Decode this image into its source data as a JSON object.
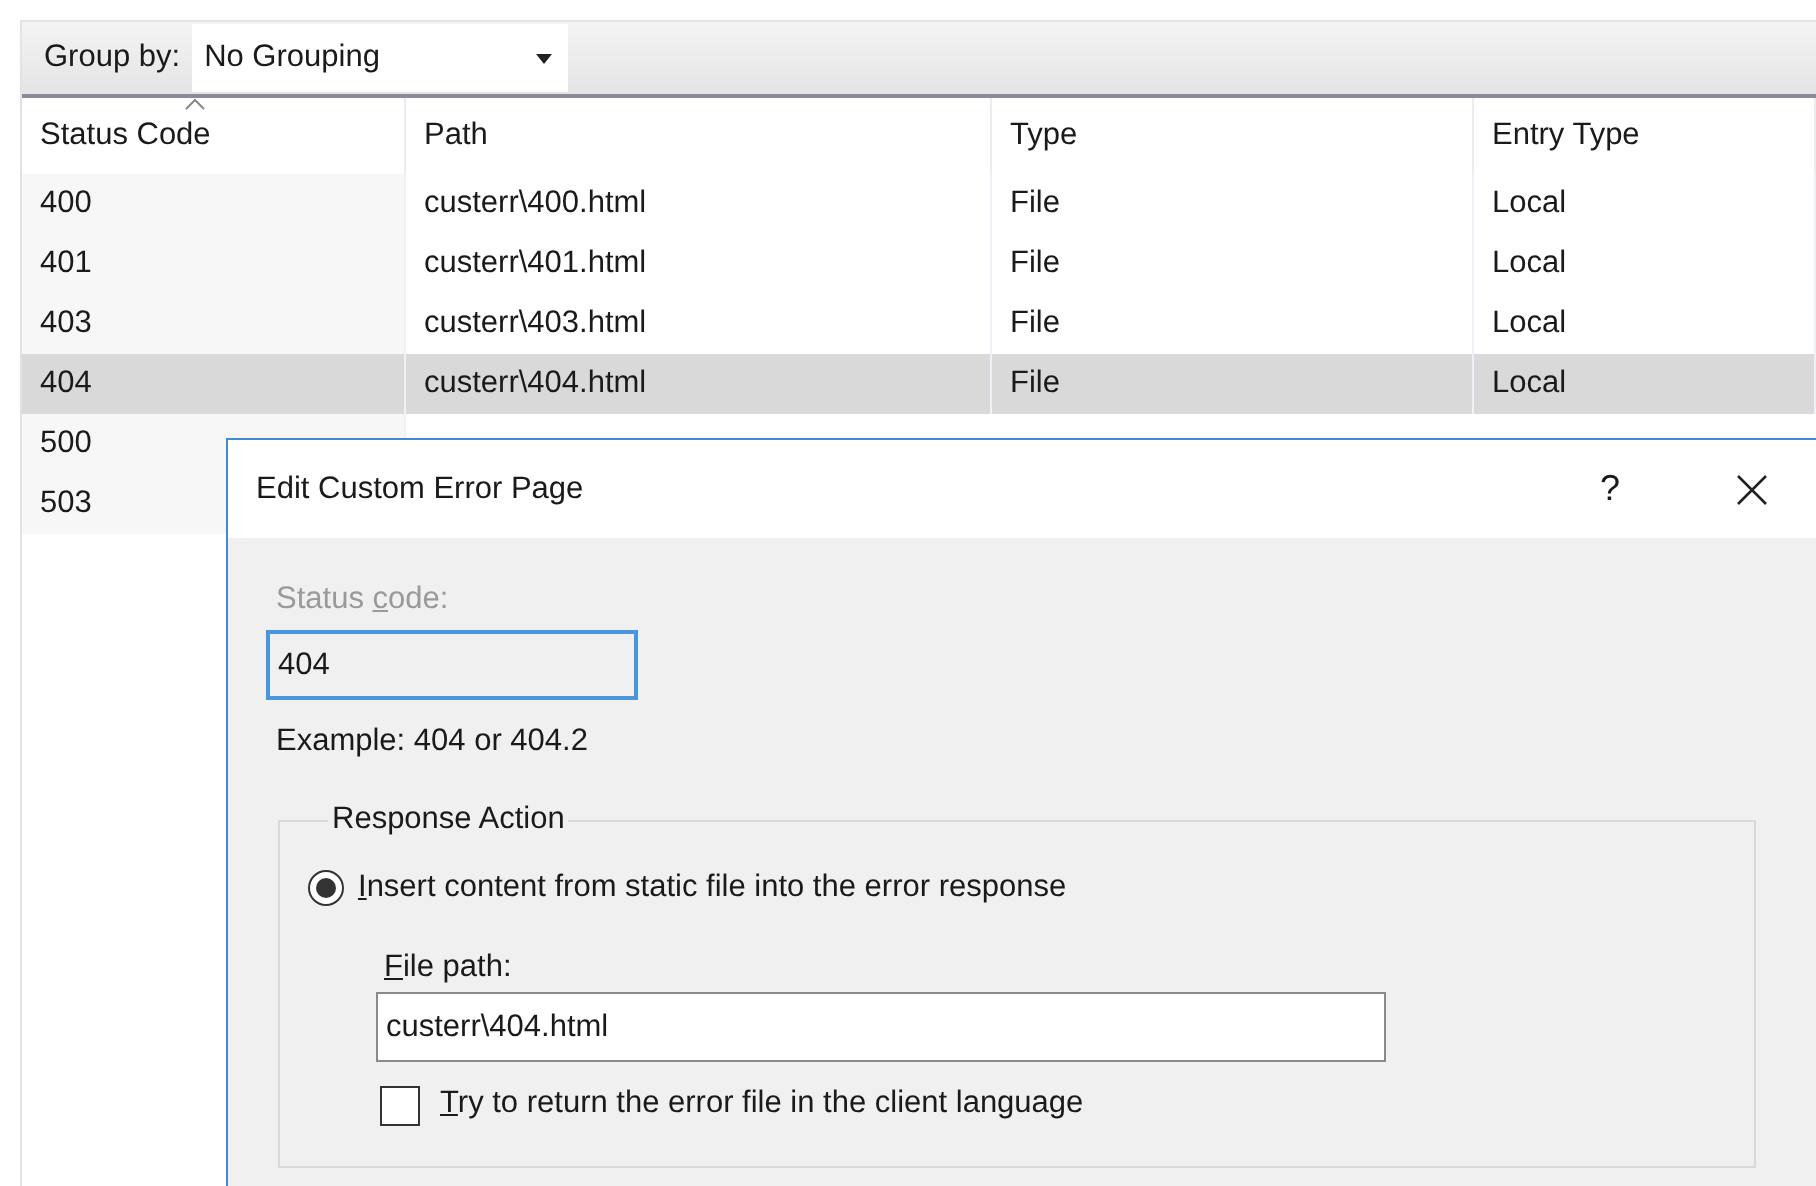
{
  "toolbar": {
    "group_by_label": "Group by:",
    "group_by_value": "No Grouping"
  },
  "table": {
    "columns": [
      {
        "label": "Status Code",
        "sorted": true
      },
      {
        "label": "Path",
        "sorted": false
      },
      {
        "label": "Type",
        "sorted": false
      },
      {
        "label": "Entry Type",
        "sorted": false
      }
    ],
    "rows": [
      {
        "cells": [
          "400",
          "custerr\\400.html",
          "File",
          "Local"
        ],
        "selected": false
      },
      {
        "cells": [
          "401",
          "custerr\\401.html",
          "File",
          "Local"
        ],
        "selected": false
      },
      {
        "cells": [
          "403",
          "custerr\\403.html",
          "File",
          "Local"
        ],
        "selected": false
      },
      {
        "cells": [
          "404",
          "custerr\\404.html",
          "File",
          "Local"
        ],
        "selected": true
      },
      {
        "cells": [
          "500"
        ],
        "selected": false
      },
      {
        "cells": [
          "503"
        ],
        "selected": false
      }
    ]
  },
  "dialog": {
    "title": "Edit Custom Error Page",
    "help": "?",
    "status_code": {
      "label_start": "Status ",
      "access_key": "c",
      "label_end": "ode:",
      "value": "404",
      "disabled": true
    },
    "example": "Example: 404 or 404.2",
    "response_action": {
      "legend": "Response Action",
      "option": {
        "access_key": "I",
        "label_end": "nsert content from static file into the error response",
        "selected": true
      },
      "file_path": {
        "access_key": "F",
        "label_end": "ile path:",
        "value": "custerr\\404.html"
      },
      "localize": {
        "access_key": "T",
        "label_end": "ry to return the error file in the client language",
        "checked": false
      }
    }
  }
}
